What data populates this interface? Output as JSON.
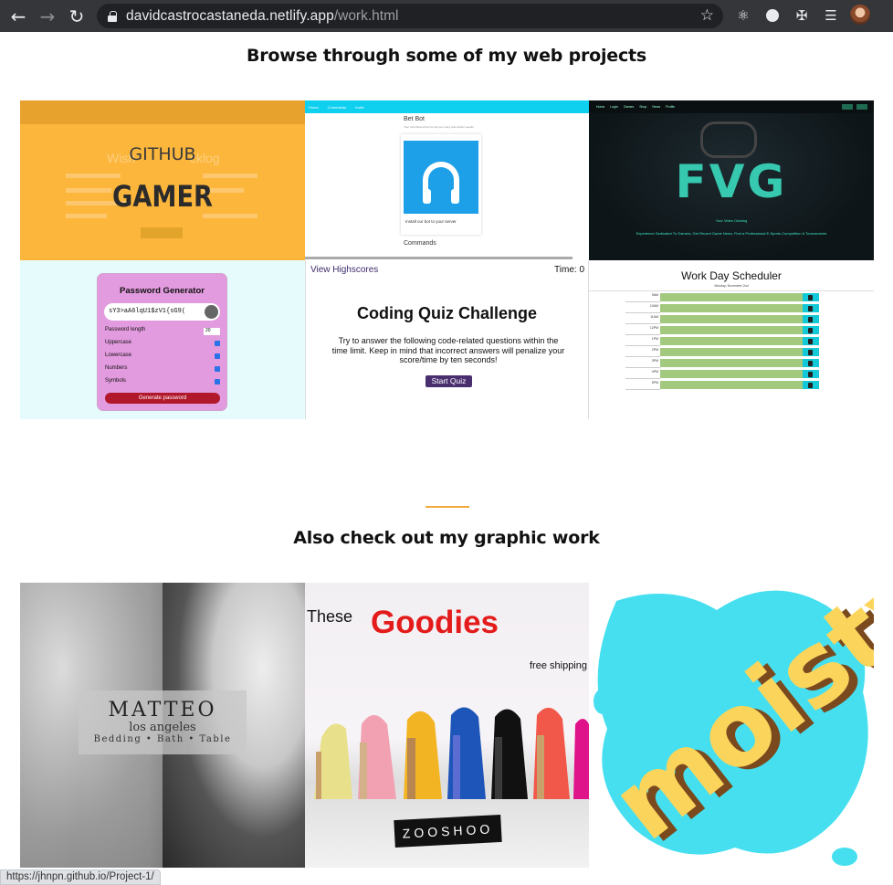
{
  "browser": {
    "url_host": "davidcastrocastaneda.netlify.app",
    "url_path": "/work.html",
    "status_url": "https://jhnpn.github.io/Project-1/"
  },
  "sections": {
    "web_heading": "Browse through some of my web projects",
    "graphic_heading": "Also check out my graphic work"
  },
  "web_projects": {
    "gamer": {
      "ghost": "Wish",
      "ghost2": "cklog",
      "title1": "GITHUB",
      "title2": "GAMER"
    },
    "betbot": {
      "nav": [
        "Home",
        "Commands",
        "Invite"
      ],
      "title": "Bet Bot",
      "subtitle": "Your own Discord bot for all your crazy and crazier needs!",
      "install": "Install our bot to your server",
      "commands": "Commands"
    },
    "fvg": {
      "logo": "FVG",
      "nav": [
        "Home",
        "Login",
        "Games",
        "Shop",
        "News",
        "Profile"
      ],
      "line1": "Your Video Gaming",
      "line2": "Experience Dedicated To Gamers, Get Recent Game News, Find a Professional E-Sports Competition & Tournaments"
    },
    "password": {
      "title": "Password Generator",
      "value": "sY3>aA6lqU1$zV1{sG9(",
      "rows": [
        "Password length",
        "Uppercase",
        "Lowercase",
        "Numbers",
        "Symbols"
      ],
      "length_value": "20",
      "button": "Generate password"
    },
    "quiz": {
      "view_highscores": "View Highscores",
      "time": "Time: 0",
      "title": "Coding Quiz Challenge",
      "body": "Try to answer the following code-related questions within the time limit. Keep in mind that incorrect answers will penalize your score/time by ten seconds!",
      "start": "Start Quiz"
    },
    "scheduler": {
      "title": "Work Day Scheduler",
      "date": "Monday, November 2nd",
      "hours": [
        "9AM",
        "10AM",
        "11AM",
        "12PM",
        "1PM",
        "2PM",
        "3PM",
        "4PM",
        "5PM"
      ]
    }
  },
  "graphic_work": {
    "matteo": {
      "name": "MATTEO",
      "city": "los angeles",
      "tagline": "Bedding • Bath • Table"
    },
    "goodies": {
      "these": "These",
      "goodies": "Goodies",
      "free": "free shipping",
      "brand": "ZOOSHOO"
    },
    "moisty": {
      "word": "moisty",
      "colors": {
        "blob": "#45dff0",
        "letters": "#fbd55b",
        "shadow": "#7a4a1e"
      }
    }
  },
  "colors": {
    "accent": "#f0a940",
    "chrome": "#35363a"
  },
  "icons": [
    "back-arrow-icon",
    "forward-arrow-icon",
    "reload-icon",
    "lock-icon",
    "star-icon",
    "react-icon",
    "extension-icon",
    "puzzle-icon",
    "media-icon",
    "avatar"
  ]
}
